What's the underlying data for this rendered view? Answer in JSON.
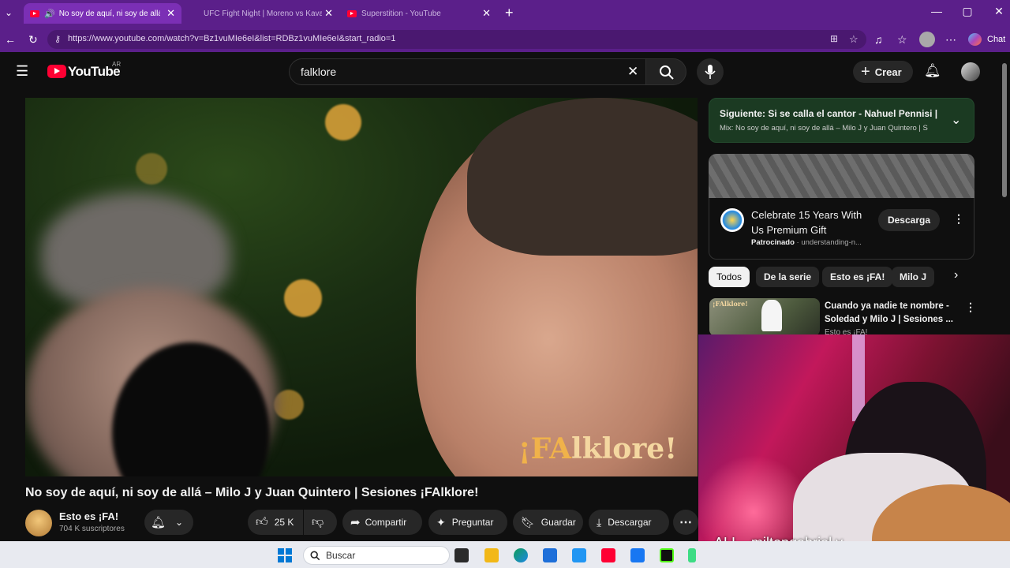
{
  "browser": {
    "tabs": [
      {
        "title": "No soy de aquí, ni soy de allá",
        "active": true
      },
      {
        "title": "UFC Fight Night | Moreno vs Kavanagh",
        "active": false
      },
      {
        "title": "Superstition - YouTube",
        "active": false
      }
    ],
    "url": "https://www.youtube.com/watch?v=Bz1vuMIe6eI&list=RDBz1vuMIe6eI&start_radio=1",
    "chat_label": "Chat",
    "accent": "#5b1f8a"
  },
  "header": {
    "logo_text": "YouTube",
    "region": "AR",
    "search_value": "falklore",
    "create_label": "Crear"
  },
  "video": {
    "overlay_brand_prefix": "¡FA",
    "overlay_brand_suffix": "lklore!",
    "title": "No soy de aquí, ni soy de allá – Milo J y Juan Quintero | Sesiones ¡FAlklore!",
    "channel": "Esto es ¡FA!",
    "subscribers": "704 K suscriptores",
    "likes": "25 K",
    "share_label": "Compartir",
    "ask_label": "Preguntar",
    "save_label": "Guardar",
    "download_label": "Descargar"
  },
  "sidebar": {
    "next_title": "Siguiente: Si se calla el cantor - Nahuel Pennisi | S...",
    "next_mix": "Mix: No soy de aquí, ni soy de allá – Milo J y Juan Quintero | S",
    "ad_title": "Celebrate 15 Years With Us Premium Gift",
    "ad_sponsored": "Patrocinado",
    "ad_domain": "· understanding-n...",
    "ad_button": "Descarga",
    "chips": [
      "Todos",
      "De la serie",
      "Esto es ¡FA!",
      "Milo J"
    ],
    "rec_title": "Cuando ya nadie te nombre - Soledad y Milo J | Sesiones ...",
    "rec_channel": "Esto es ¡FA!",
    "rec_thumb_brand": "¡FAlklore!"
  },
  "webcam": {
    "label": "ALI... miltongabriel.v"
  },
  "taskbar": {
    "search_placeholder": "Buscar"
  }
}
